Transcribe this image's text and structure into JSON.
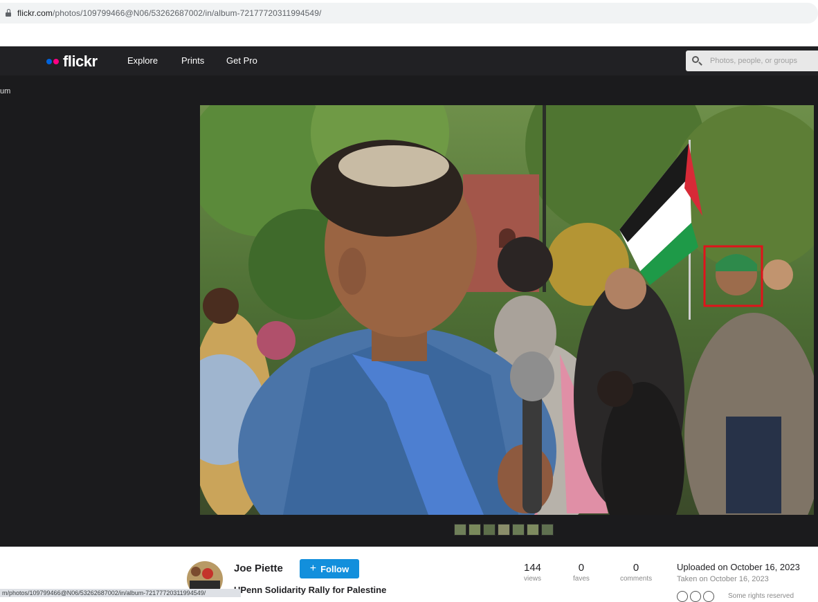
{
  "browser": {
    "url_host": "flickr.com",
    "url_path": "/photos/109799466@N06/53262687002/in/album-72177720311994549/"
  },
  "header": {
    "logo": "flickr",
    "nav": [
      "Explore",
      "Prints",
      "Get Pro"
    ],
    "search_placeholder": "Photos, people, or groups"
  },
  "photo_area": {
    "back_link": "um",
    "thumbnail_count": 7
  },
  "photo_info": {
    "author": "Joe Piette",
    "follow_label": "Follow",
    "title": "UPenn Solidarity Rally for Palestine",
    "stats": [
      {
        "value": "144",
        "label": "views"
      },
      {
        "value": "0",
        "label": "faves"
      },
      {
        "value": "0",
        "label": "comments"
      }
    ],
    "uploaded": "Uploaded on October 16, 2023",
    "taken": "Taken on October 16, 2023",
    "license": "Some rights reserved"
  },
  "status_bar": {
    "text": "m/photos/109799466@N06/53262687002/in/album-72177720311994549/"
  },
  "colors": {
    "header_bg": "#212124",
    "photo_bg": "#1b1b1d",
    "follow_blue": "#128fdc",
    "flickr_blue": "#0063dc",
    "flickr_pink": "#ff0084",
    "highlight_box": "#e0131b"
  }
}
